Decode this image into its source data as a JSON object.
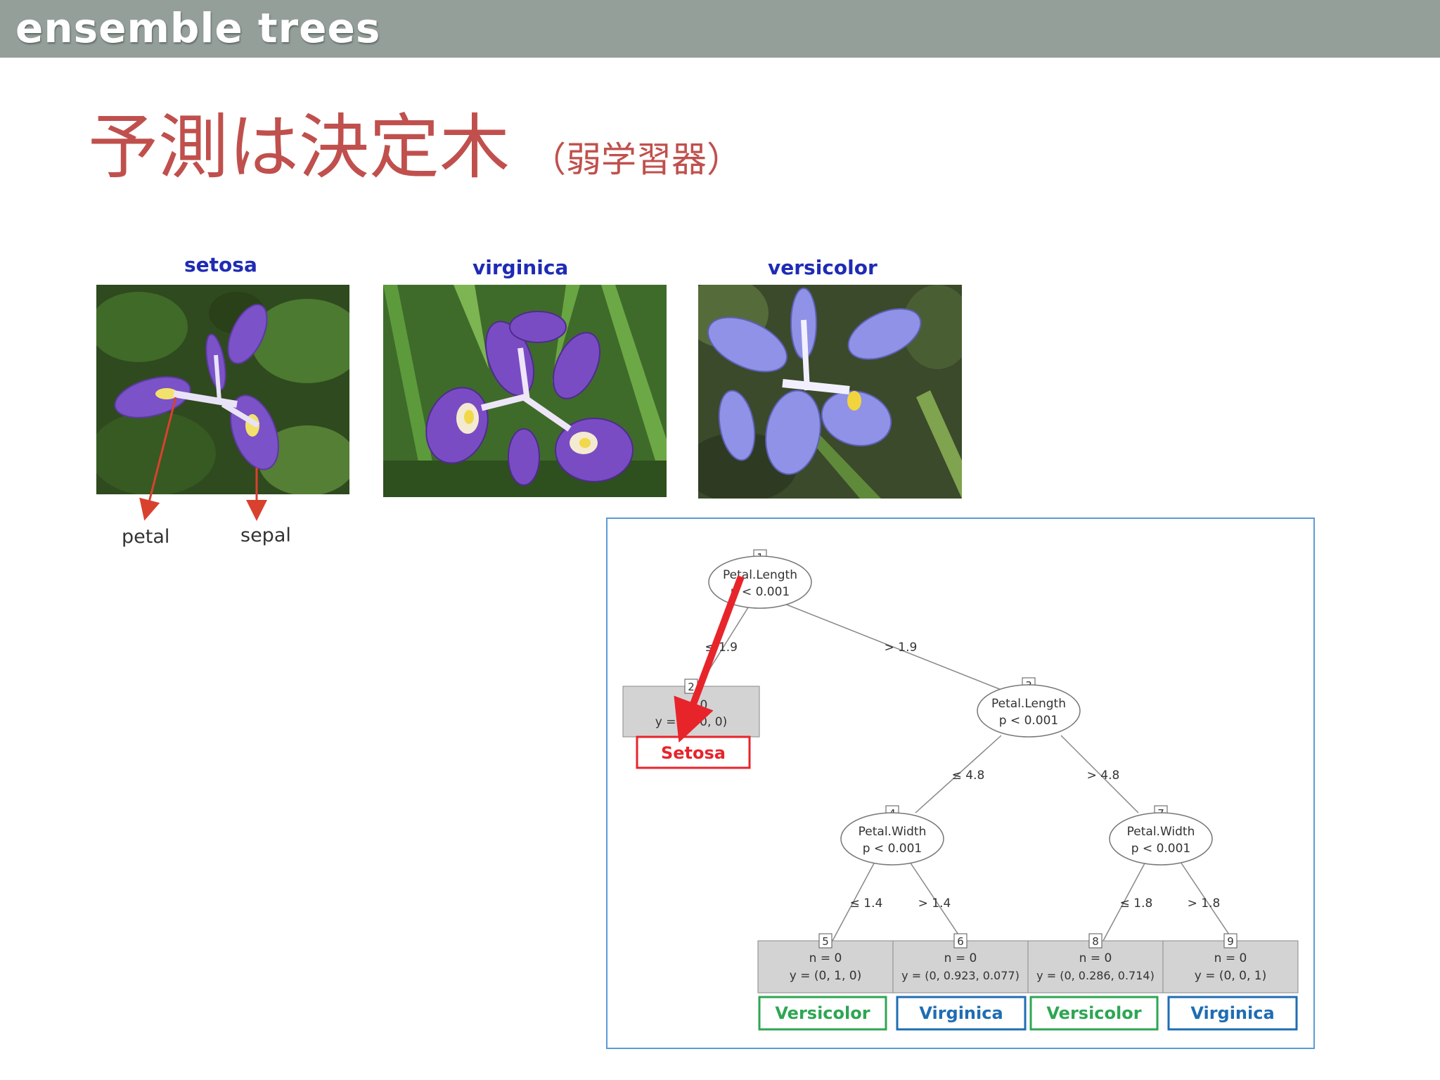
{
  "header": {
    "title": "ensemble trees"
  },
  "slide": {
    "title": "予測は決定木",
    "subtitle": "（弱学習器）"
  },
  "flowers": [
    {
      "name": "setosa"
    },
    {
      "name": "virginica"
    },
    {
      "name": "versicolor"
    }
  ],
  "parts": {
    "petal": "petal",
    "sepal": "sepal"
  },
  "tree": {
    "nodes": {
      "n1": {
        "id": "1",
        "var": "Petal.Length",
        "p": "p < 0.001"
      },
      "n3": {
        "id": "3",
        "var": "Petal.Length",
        "p": "p < 0.001"
      },
      "n4": {
        "id": "4",
        "var": "Petal.Width",
        "p": "p < 0.001"
      },
      "n7": {
        "id": "7",
        "var": "Petal.Width",
        "p": "p < 0.001"
      }
    },
    "edges": {
      "e1l": "≤ 1.9",
      "e1r": "> 1.9",
      "e3l": "≤ 4.8",
      "e3r": "> 4.8",
      "e4l": "≤ 1.4",
      "e4r": "> 1.4",
      "e7l": "≤ 1.8",
      "e7r": "> 1.8"
    },
    "leaves": {
      "l2": {
        "id": "2",
        "n": "n = 0",
        "y": "y = (1, 0, 0)",
        "label": "Setosa",
        "color": "#e8242b"
      },
      "l5": {
        "id": "5",
        "n": "n = 0",
        "y": "y = (0, 1, 0)",
        "label": "Versicolor",
        "color": "#2ea653"
      },
      "l6": {
        "id": "6",
        "n": "n = 0",
        "y": "y = (0, 0.923, 0.077)",
        "label": "Virginica",
        "color": "#1f6db3"
      },
      "l8": {
        "id": "8",
        "n": "n = 0",
        "y": "y = (0, 0.286, 0.714)",
        "label": "Versicolor",
        "color": "#2ea653"
      },
      "l9": {
        "id": "9",
        "n": "n = 0",
        "y": "y = (0, 0, 1)",
        "label": "Virginica",
        "color": "#1f6db3"
      }
    }
  },
  "colors": {
    "header_bg": "#939f98",
    "title": "#c0504d",
    "flower_label": "#1f2bb5",
    "arrow": "#e8242b",
    "panel_border": "#5b9bd5",
    "leaf_box": "#d3d3d3"
  }
}
